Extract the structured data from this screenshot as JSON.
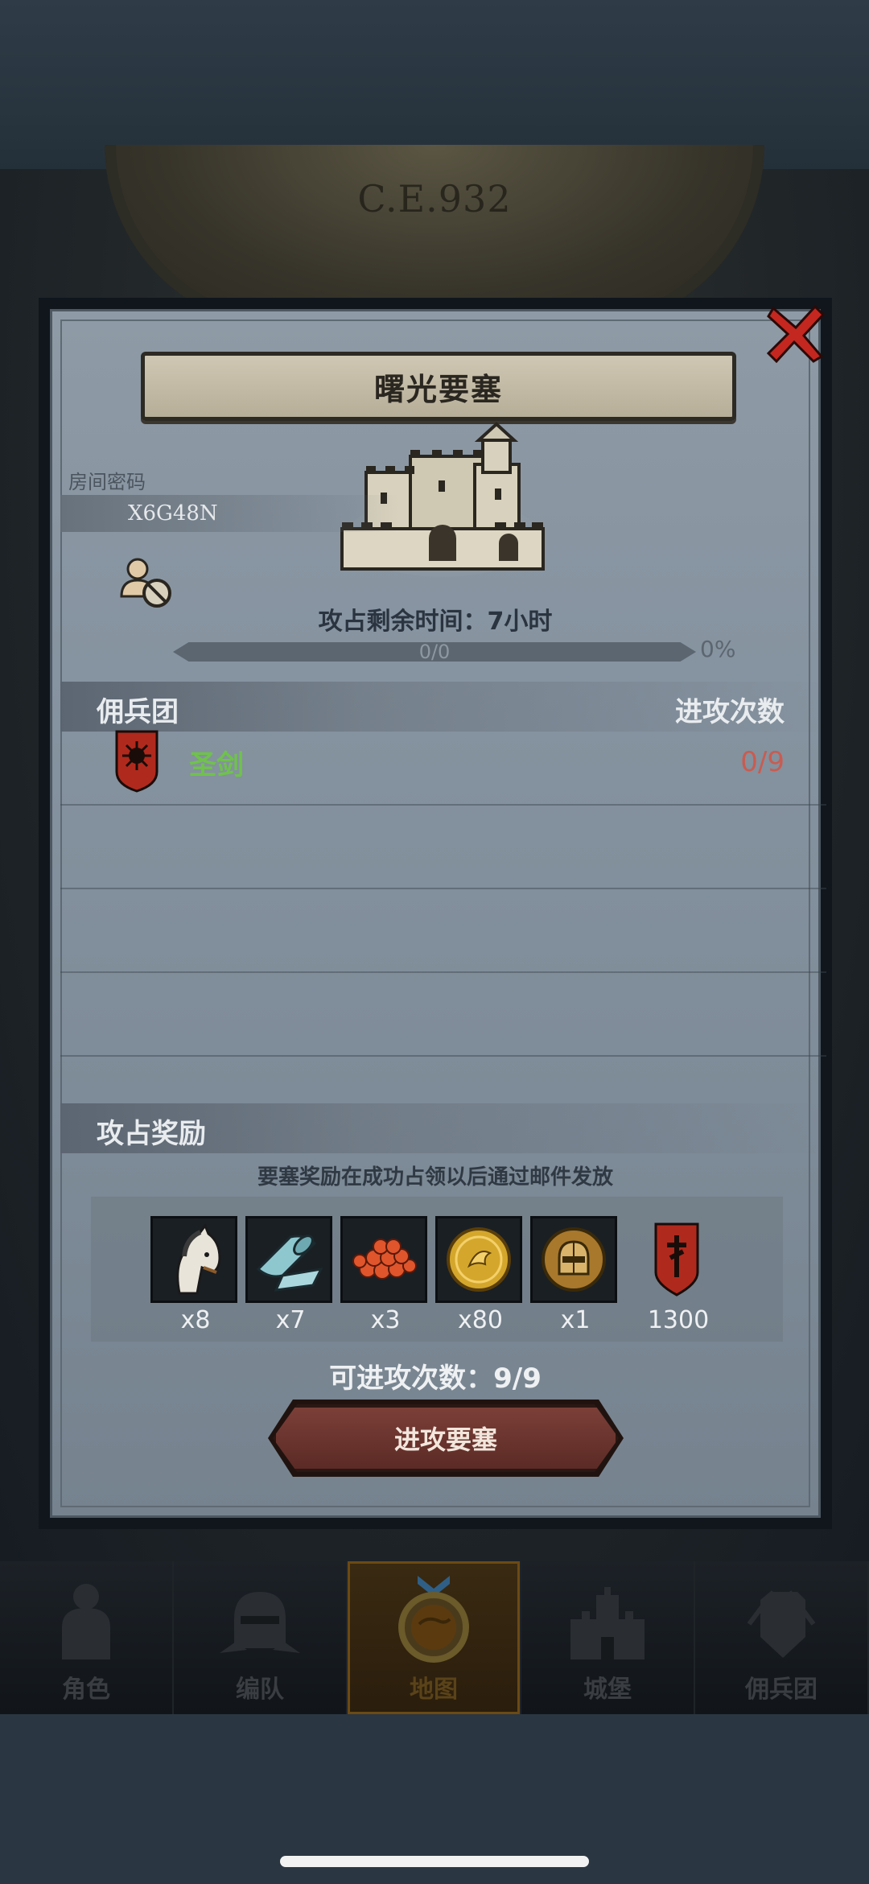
{
  "background": {
    "era": "C.E.932"
  },
  "modal": {
    "title": "曙光要塞",
    "room_label": "房间密码",
    "room_code": "X6G48N",
    "time_remaining": "攻占剩余时间：7小时",
    "progress": {
      "text": "0/0",
      "percent_label": "0%",
      "value": 0
    },
    "mercenary_section": {
      "label": "佣兵团",
      "count_header": "进攻次数",
      "rows": [
        {
          "name": "圣剑",
          "attacks": "0/9"
        }
      ]
    },
    "reward_section": {
      "label": "攻占奖励",
      "note": "要塞奖励在成功占领以后通过邮件发放",
      "items": [
        {
          "icon": "horse-icon",
          "qty": "x8"
        },
        {
          "icon": "cloth-roll-icon",
          "qty": "x7"
        },
        {
          "icon": "orange-gems-icon",
          "qty": "x3"
        },
        {
          "icon": "gold-coin-icon",
          "qty": "x80"
        },
        {
          "icon": "knight-helmet-icon",
          "qty": "x1"
        },
        {
          "icon": "honor-banner-icon",
          "qty": "1300"
        }
      ]
    },
    "attack_count": "可进攻次数：9/9",
    "attack_button": "进攻要塞"
  },
  "bottom_nav": {
    "items": [
      {
        "label": "角色",
        "icon": "knight-icon"
      },
      {
        "label": "编队",
        "icon": "helmet-icon"
      },
      {
        "label": "地图",
        "icon": "map-icon",
        "active": true
      },
      {
        "label": "城堡",
        "icon": "castle-icon"
      },
      {
        "label": "佣兵团",
        "icon": "mercenary-icon"
      }
    ]
  },
  "colors": {
    "modal_bg": "#8693a0",
    "merc_name": "#6fc24c",
    "merc_count": "#c95c50",
    "button": "#6b342e",
    "close_red": "#c4271f"
  }
}
